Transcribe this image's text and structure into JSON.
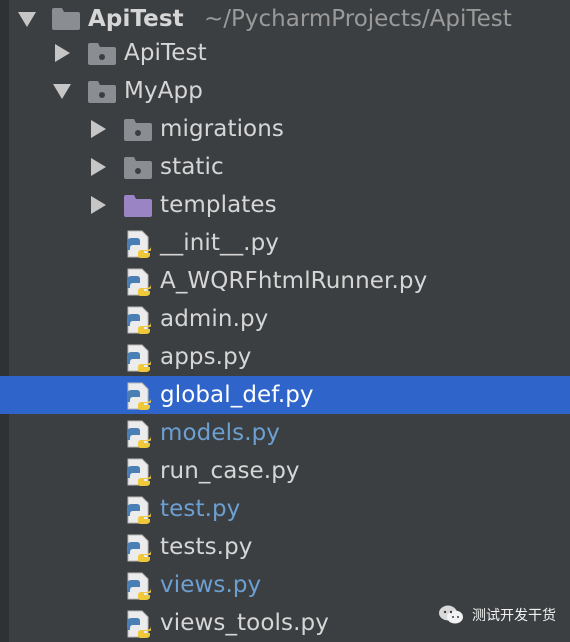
{
  "tree": {
    "rows": [
      {
        "label": "ApiTest",
        "path": "~/PycharmProjects/ApiTest",
        "type": "project-folder",
        "expanded": true
      },
      {
        "label": "ApiTest",
        "type": "package-folder",
        "expanded": false
      },
      {
        "label": "MyApp",
        "type": "package-folder",
        "expanded": true
      },
      {
        "label": "migrations",
        "type": "package-folder",
        "expanded": false
      },
      {
        "label": "static",
        "type": "package-folder",
        "expanded": false
      },
      {
        "label": "templates",
        "type": "templates-folder",
        "expanded": false
      },
      {
        "label": "__init__.py",
        "type": "python-file",
        "status": "normal"
      },
      {
        "label": "A_WQRFhtmlRunner.py",
        "type": "python-file",
        "status": "normal"
      },
      {
        "label": "admin.py",
        "type": "python-file",
        "status": "normal"
      },
      {
        "label": "apps.py",
        "type": "python-file",
        "status": "normal"
      },
      {
        "label": "global_def.py",
        "type": "python-file",
        "status": "selected"
      },
      {
        "label": "models.py",
        "type": "python-file",
        "status": "modified"
      },
      {
        "label": "run_case.py",
        "type": "python-file",
        "status": "normal"
      },
      {
        "label": "test.py",
        "type": "python-file",
        "status": "modified"
      },
      {
        "label": "tests.py",
        "type": "python-file",
        "status": "normal"
      },
      {
        "label": "views.py",
        "type": "python-file",
        "status": "modified"
      },
      {
        "label": "views_tools.py",
        "type": "python-file",
        "status": "normal"
      }
    ]
  },
  "watermark": {
    "text": "测试开发干货",
    "icon": "wechat-icon"
  },
  "colors": {
    "background": "#3c3f41",
    "selection": "#2f65ca",
    "text": "#d6d6d6",
    "modified_text": "#6c9fd2",
    "folder": "#8a8d91",
    "templates_folder": "#9b84c3",
    "python_blue": "#4a7fb5",
    "python_yellow": "#f0c93b"
  }
}
